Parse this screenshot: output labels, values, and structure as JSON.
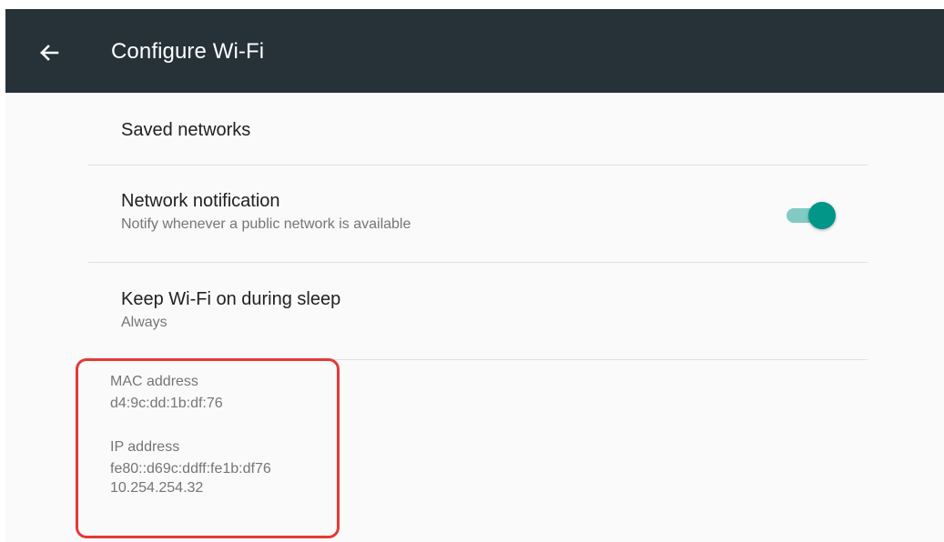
{
  "app_bar": {
    "title": "Configure Wi-Fi",
    "back_icon": "arrow-back-icon",
    "background": "#263238"
  },
  "settings": {
    "saved_networks": {
      "title": "Saved networks"
    },
    "network_notification": {
      "title": "Network notification",
      "summary": "Notify whenever a public network is available",
      "toggle_on": true,
      "toggle_color": "#009688"
    },
    "keep_wifi_on": {
      "title": "Keep Wi-Fi on during sleep",
      "summary": "Always"
    }
  },
  "info": {
    "mac_label": "MAC address",
    "mac_value": "d4:9c:dd:1b:df:76",
    "ip_label": "IP address",
    "ip_value_v6": "fe80::d69c:ddff:fe1b:df76",
    "ip_value_v4": "10.254.254.32"
  },
  "annotation": {
    "highlight_color": "#e53935"
  }
}
